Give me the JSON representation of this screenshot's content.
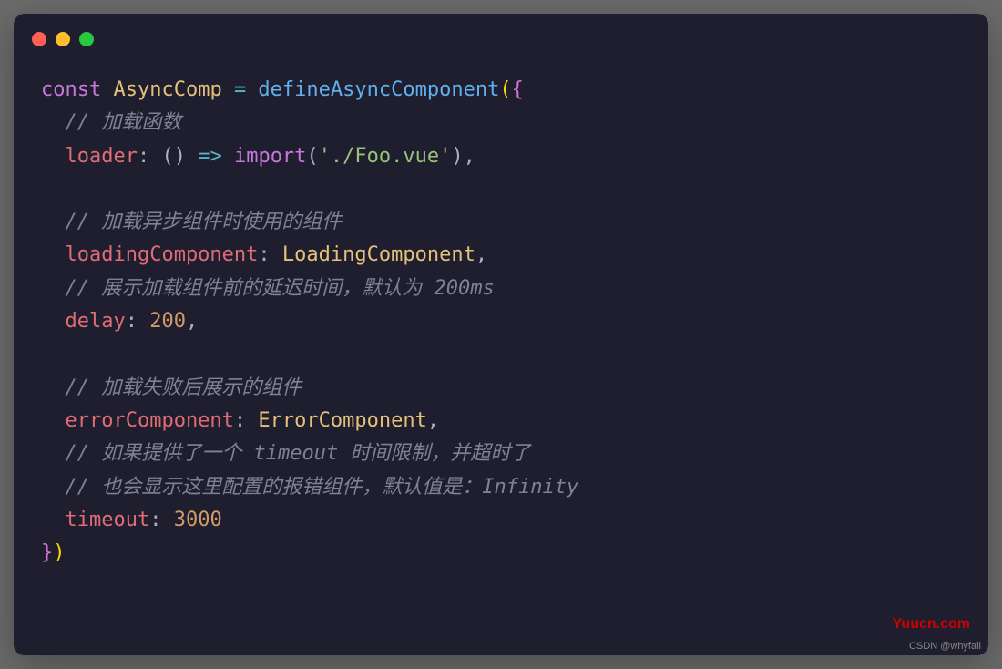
{
  "code": {
    "line1_const": "const",
    "line1_var": " AsyncComp ",
    "line1_eq": "=",
    "line1_func": " defineAsyncComponent",
    "line1_paren_open": "(",
    "line1_brace_open": "{",
    "line2_comment": "  // 加载函数",
    "line3_prop": "  loader",
    "line3_colon": ": ",
    "line3_paren": "()",
    "line3_arrow": " => ",
    "line3_import": "import",
    "line3_paren2_open": "(",
    "line3_string": "'./Foo.vue'",
    "line3_paren2_close": ")",
    "line3_comma": ",",
    "line4_empty": "",
    "line5_comment": "  // 加载异步组件时使用的组件",
    "line6_prop": "  loadingComponent",
    "line6_colon": ": ",
    "line6_val": "LoadingComponent",
    "line6_comma": ",",
    "line7_comment": "  // 展示加载组件前的延迟时间，默认为 200ms",
    "line8_prop": "  delay",
    "line8_colon": ": ",
    "line8_num": "200",
    "line8_comma": ",",
    "line9_empty": "",
    "line10_comment": "  // 加载失败后展示的组件",
    "line11_prop": "  errorComponent",
    "line11_colon": ": ",
    "line11_val": "ErrorComponent",
    "line11_comma": ",",
    "line12_comment": "  // 如果提供了一个 timeout 时间限制，并超时了",
    "line13_comment": "  // 也会显示这里配置的报错组件，默认值是：Infinity",
    "line14_prop": "  timeout",
    "line14_colon": ": ",
    "line14_num": "3000",
    "line15_brace_close": "}",
    "line15_paren_close": ")"
  },
  "watermarks": {
    "right": "Yuucn.com",
    "bottom": "CSDN @whyfail"
  }
}
